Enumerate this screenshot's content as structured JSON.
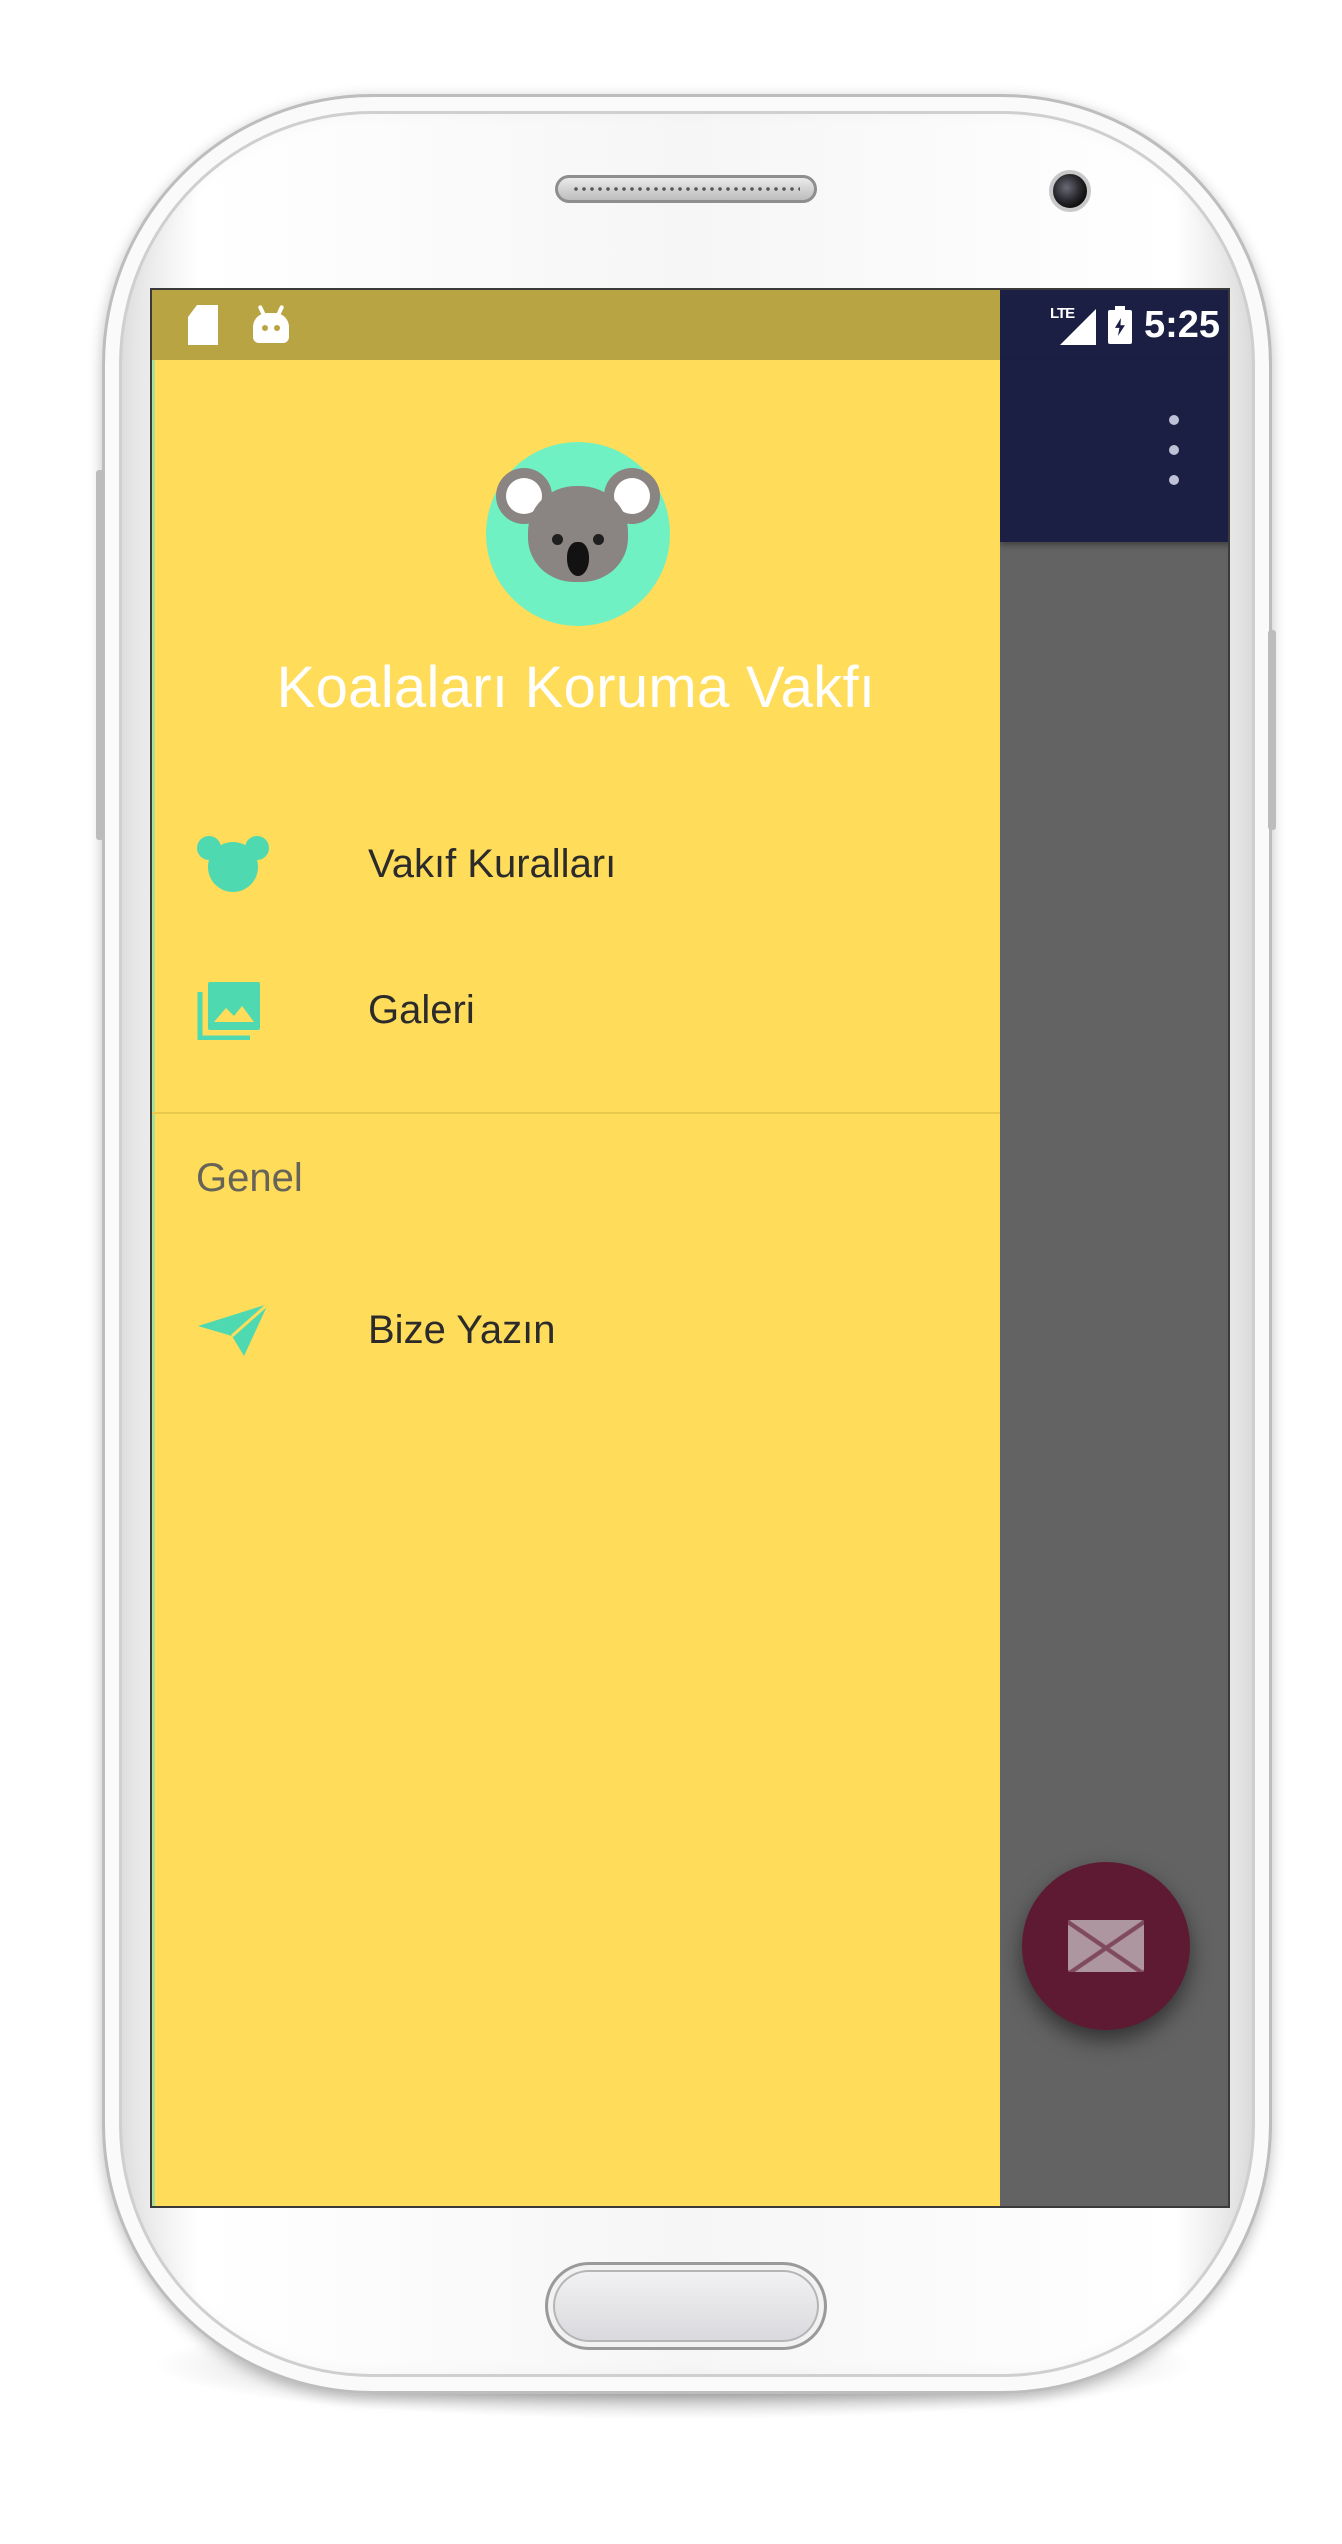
{
  "status_bar": {
    "time": "5:25",
    "network": "LTE",
    "left_icons": [
      "sd-card-icon",
      "android-icon"
    ],
    "right_icons": [
      "signal-icon",
      "battery-charging-icon"
    ]
  },
  "drawer": {
    "header_title": "Koalaları Koruma Vakfı",
    "avatar_icon": "koala-icon",
    "items": [
      {
        "label": "Vakıf Kuralları",
        "icon": "koala-head-icon"
      },
      {
        "label": "Galeri",
        "icon": "photo-library-icon"
      }
    ],
    "section_header": "Genel",
    "section_items": [
      {
        "label": "Bize Yazın",
        "icon": "send-icon"
      }
    ]
  },
  "app_bar": {
    "overflow_icon": "more-vert-icon"
  },
  "fab": {
    "icon": "mail-icon"
  },
  "colors": {
    "drawer_background": "#ffdc59",
    "drawer_status_bar": "#b9a443",
    "accent_mint": "#6ff1c4",
    "menu_icon": "#4fd9b0",
    "app_bar": "#1b1f44",
    "fab": "#5e1a33",
    "scrim": "#636363"
  }
}
